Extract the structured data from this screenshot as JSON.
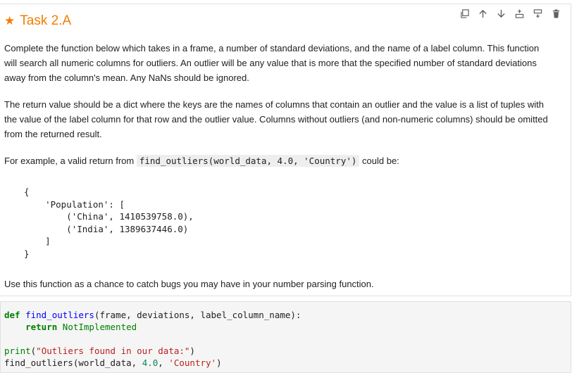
{
  "title": {
    "star": "★",
    "text": "Task 2.A"
  },
  "toolbar": {
    "buttons": [
      {
        "name": "duplicate",
        "icon": "copy-icon"
      },
      {
        "name": "move-up",
        "icon": "arrow-up-icon"
      },
      {
        "name": "move-down",
        "icon": "arrow-down-icon"
      },
      {
        "name": "insert-above",
        "icon": "insert-above-icon"
      },
      {
        "name": "insert-below",
        "icon": "insert-below-icon"
      },
      {
        "name": "delete",
        "icon": "trash-icon"
      }
    ]
  },
  "paragraphs": {
    "p1": "Complete the function below which takes in a frame, a number of standard deviations, and the name of a label column. This function will search all numeric columns for outliers. An outlier will be any value that is more that the specified number of standard deviations away from the column's mean. Any NaNs should be ignored.",
    "p2": "The return value should be a dict where the keys are the names of columns that contain an outlier and the value is a list of tuples with the value of the label column for that row and the outlier value. Columns without outliers (and non-numeric columns) should be omitted from the returned result.",
    "p3_before": "For example, a valid return from ",
    "p3_code": "find_outliers(world_data, 4.0, 'Country')",
    "p3_after": " could be:",
    "p4": "Use this function as a chance to catch bugs you may have in your number parsing function."
  },
  "example": {
    "l1": "{",
    "l2": "    'Population': [",
    "l3": "        ('China', 1410539758.0),",
    "l4": "        ('India', 1389637446.0)",
    "l5": "    ]",
    "l6": "}"
  },
  "code": {
    "def_kw": "def",
    "fn_name": "find_outliers",
    "params": "(frame, deviations, label_column_name):",
    "indent": "    ",
    "return_kw": "return",
    "not_impl": "NotImplemented",
    "print_fn": "print",
    "print_open": "(",
    "print_str": "\"Outliers found in our data:\"",
    "print_close": ")",
    "call_name": "find_outliers",
    "call_args_1": "(world_data, ",
    "call_num": "4.0",
    "call_sep": ", ",
    "call_str": "'Country'",
    "call_close": ")"
  }
}
